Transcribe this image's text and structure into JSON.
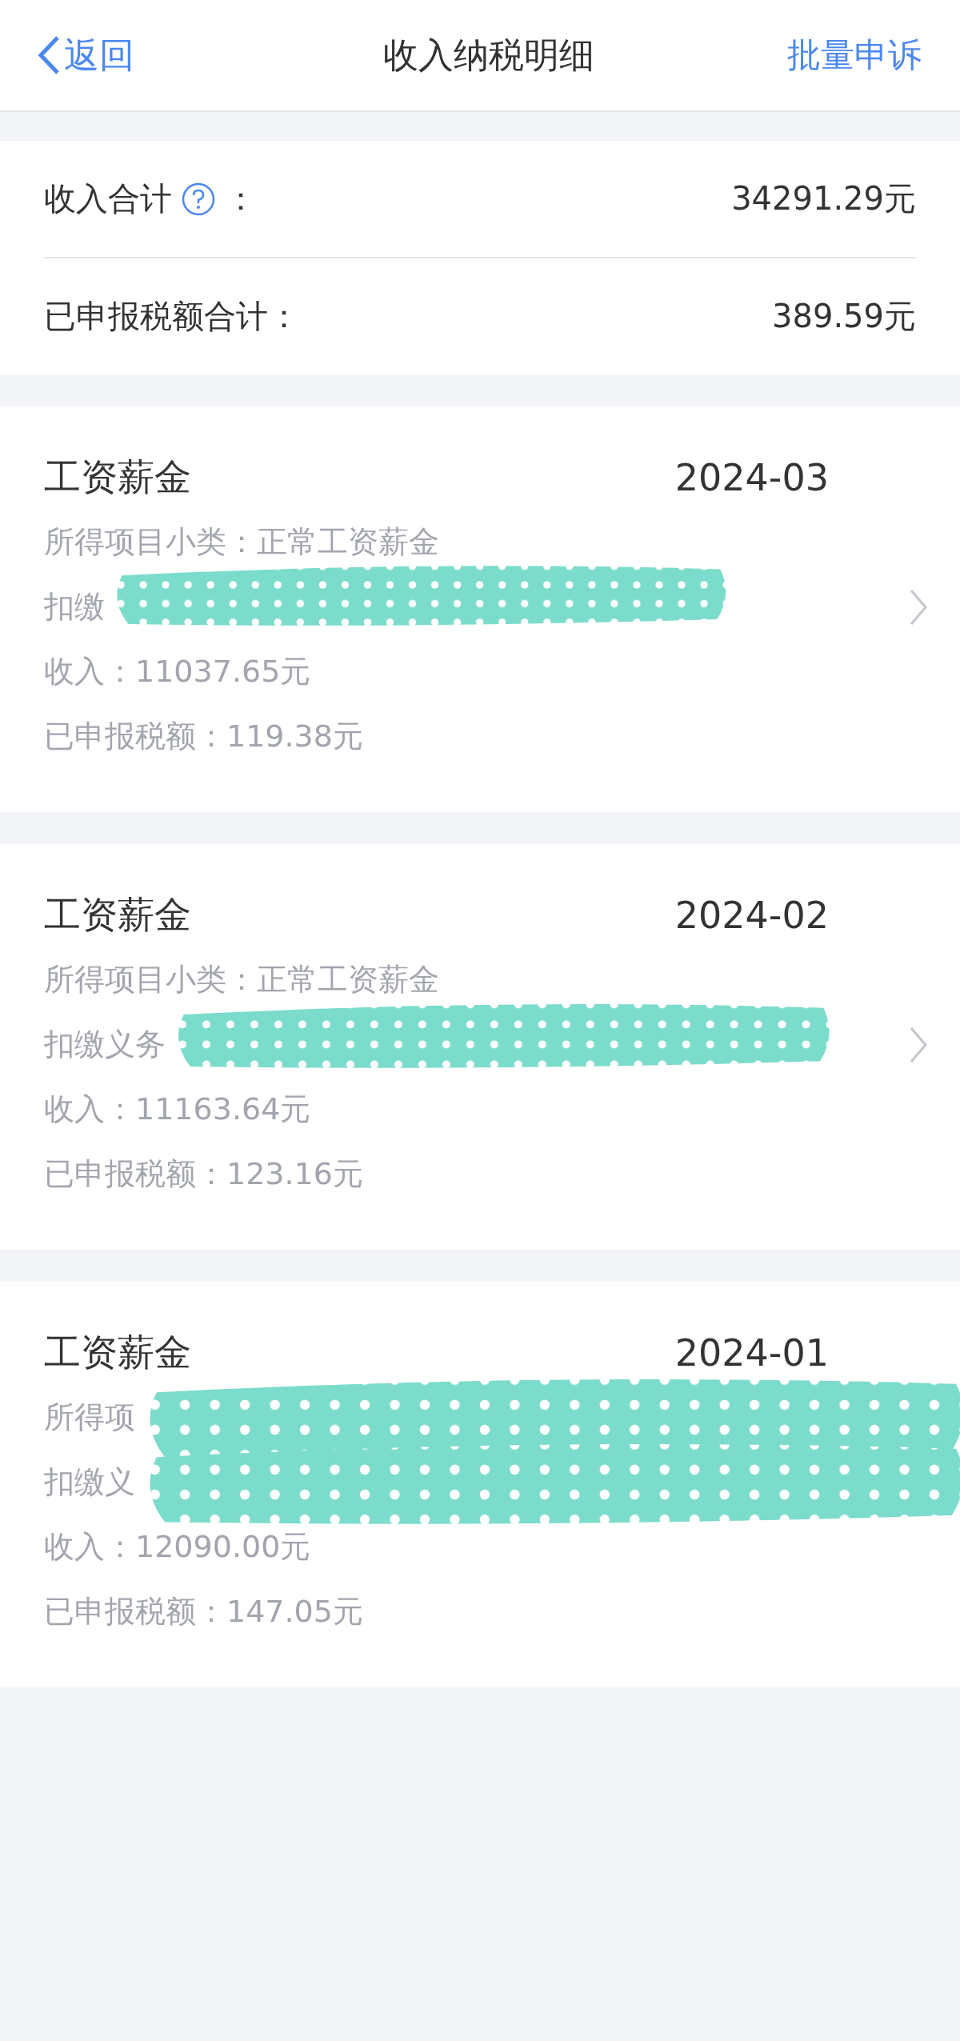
{
  "header": {
    "back": "返回",
    "title": "收入纳税明细",
    "action": "批量申诉"
  },
  "summary": [
    {
      "label": "收入合计",
      "help": true,
      "colon": "：",
      "value": "34291.29元"
    },
    {
      "label": "已申报税额合计：",
      "help": false,
      "value": "389.59元"
    }
  ],
  "records": [
    {
      "title": "工资薪金",
      "period": "2024-03",
      "chevron": true,
      "lines": [
        {
          "text": "所得项目小类：正常工资薪金",
          "redacted": false
        },
        {
          "text": "扣缴",
          "redacted": true
        },
        {
          "text": "收入：11037.65元",
          "redacted": false
        },
        {
          "text": "已申报税额：119.38元",
          "redacted": false
        }
      ]
    },
    {
      "title": "工资薪金",
      "period": "2024-02",
      "chevron": true,
      "lines": [
        {
          "text": "所得项目小类：正常工资薪金",
          "redacted": false
        },
        {
          "text": "扣缴义务",
          "redacted": true
        },
        {
          "text": "收入：11163.64元",
          "redacted": false
        },
        {
          "text": "已申报税额：123.16元",
          "redacted": false
        }
      ]
    },
    {
      "title": "工资薪金",
      "period": "2024-01",
      "chevron": false,
      "lines": [
        {
          "text": "所得项",
          "redacted": true
        },
        {
          "text": "扣缴义",
          "redacted": true
        },
        {
          "text": "收入：12090.00元",
          "redacted": false
        },
        {
          "text": "已申报税额：147.05元",
          "redacted": false
        }
      ]
    }
  ]
}
